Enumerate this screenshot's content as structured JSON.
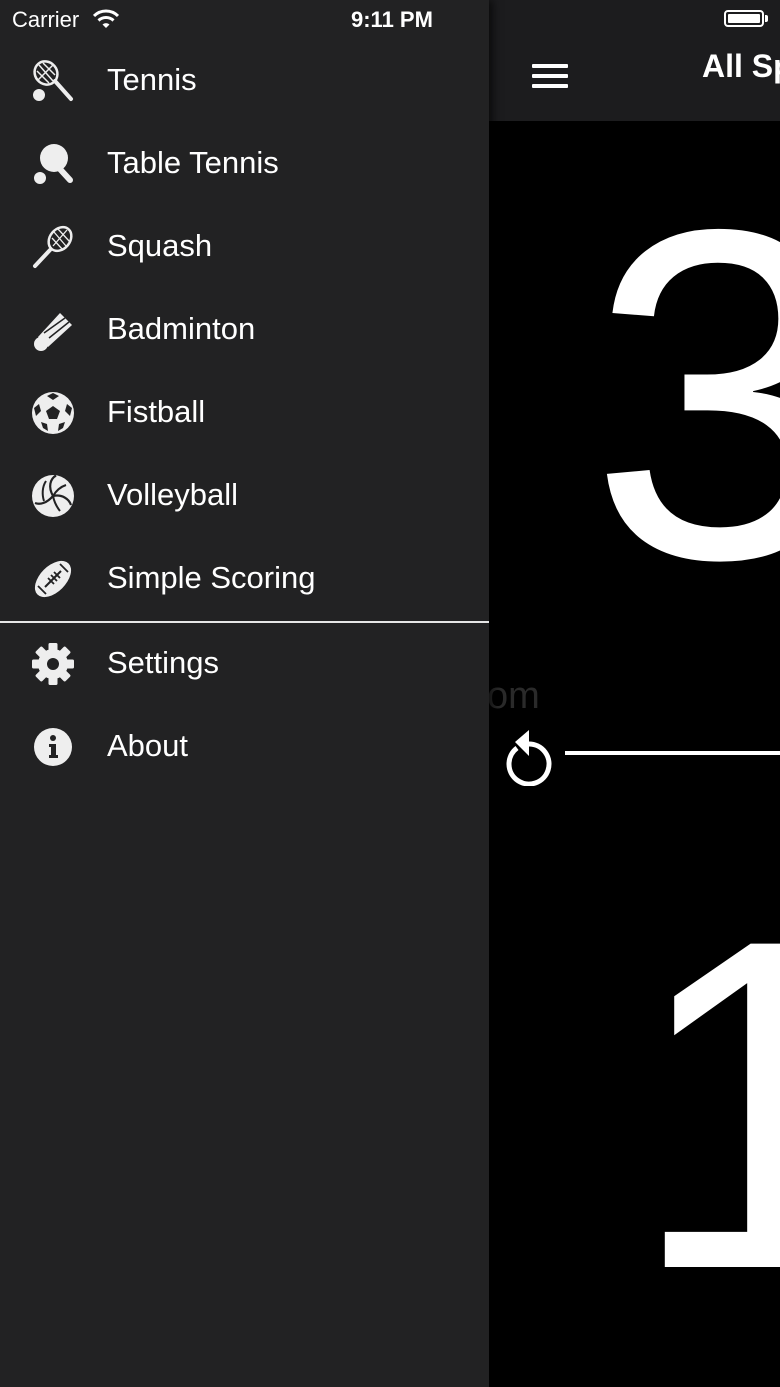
{
  "status_bar": {
    "carrier": "Carrier",
    "time": "9:11 PM"
  },
  "main": {
    "title": "All Sp",
    "score_top": "3",
    "score_bottom": "1",
    "faded_text": "om"
  },
  "drawer": {
    "sports": [
      {
        "label": "Tennis",
        "icon": "tennis-icon"
      },
      {
        "label": "Table Tennis",
        "icon": "table-tennis-icon"
      },
      {
        "label": "Squash",
        "icon": "squash-icon"
      },
      {
        "label": "Badminton",
        "icon": "badminton-icon"
      },
      {
        "label": "Fistball",
        "icon": "fistball-icon"
      },
      {
        "label": "Volleyball",
        "icon": "volleyball-icon"
      },
      {
        "label": "Simple Scoring",
        "icon": "football-icon"
      }
    ],
    "extras": [
      {
        "label": "Settings",
        "icon": "gear-icon"
      },
      {
        "label": "About",
        "icon": "info-icon"
      }
    ]
  },
  "colors": {
    "drawer_bg": "#222223",
    "nav_bg": "#1c1c1e",
    "text": "#ffffff"
  }
}
